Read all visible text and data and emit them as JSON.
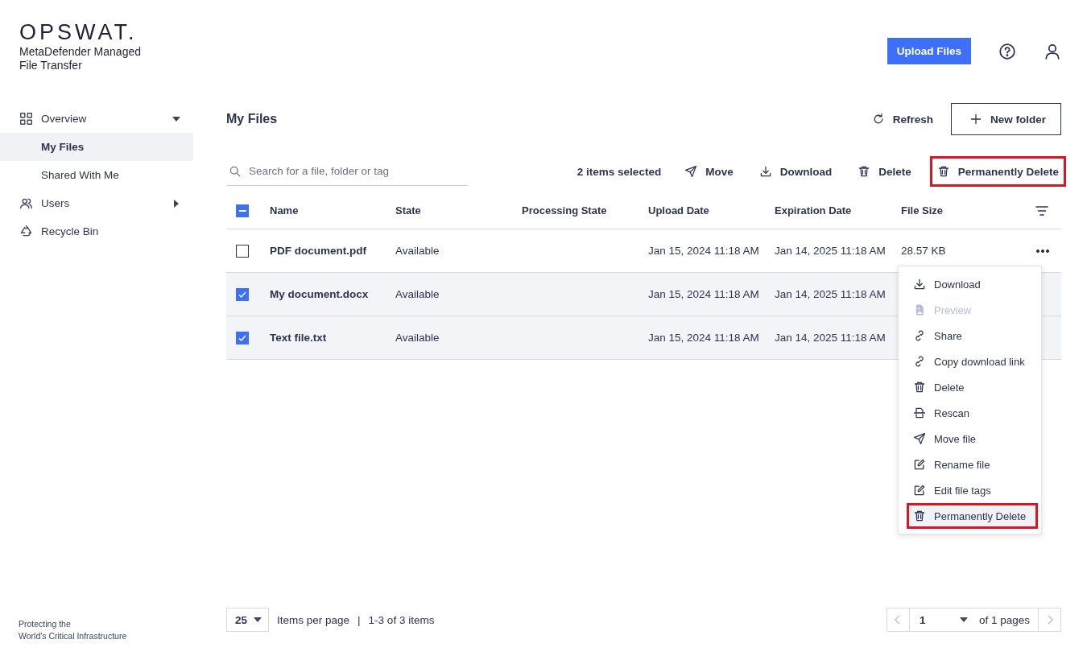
{
  "brand": {
    "logo": "OPSWAT.",
    "product": "MetaDefender Managed File Transfer",
    "tagline_lines": [
      "Protecting the",
      "World's Critical Infrastructure"
    ]
  },
  "header": {
    "upload_button": "Upload Files"
  },
  "sidebar": {
    "items": [
      {
        "label": "Overview",
        "expanded": true,
        "children": [
          {
            "label": "My Files",
            "selected": true
          },
          {
            "label": "Shared With Me",
            "selected": false
          }
        ]
      },
      {
        "label": "Users",
        "expanded": false
      },
      {
        "label": "Recycle Bin"
      }
    ]
  },
  "page": {
    "title": "My Files",
    "refresh": "Refresh",
    "new_folder": "New folder"
  },
  "search": {
    "placeholder": "Search for a file, folder or tag"
  },
  "bulk_actions": {
    "count": "2 items selected",
    "actions": [
      {
        "label": "Move",
        "highlighted": false
      },
      {
        "label": "Download",
        "highlighted": false
      },
      {
        "label": "Delete",
        "highlighted": false
      },
      {
        "label": "Permanently Delete",
        "highlighted": true
      }
    ]
  },
  "table": {
    "select_all": {
      "indeterminate": true
    },
    "columns": [
      "Name",
      "State",
      "Processing State",
      "Upload Date",
      "Expiration Date",
      "File Size"
    ],
    "rows": [
      {
        "name": "PDF document.pdf",
        "state": "Available",
        "processing_state": "",
        "upload": "Jan 15, 2024 11:18 AM",
        "expiration": "Jan 14, 2025 11:18 AM",
        "size": "28.57 KB",
        "selected": false
      },
      {
        "name": "My document.docx",
        "state": "Available",
        "upload": "Jan 15, 2024 11:18 AM",
        "expiration": "Jan 14, 2025 11:18 AM",
        "selected": true
      },
      {
        "name": "Text file.txt",
        "state": "Available",
        "upload": "Jan 15, 2024 11:18 AM",
        "expiration": "Jan 14, 2025 11:18 AM",
        "selected": true
      }
    ]
  },
  "context_menu": {
    "items": [
      {
        "label": "Download",
        "disabled": false,
        "highlighted": false
      },
      {
        "label": "Preview",
        "disabled": true,
        "highlighted": false
      },
      {
        "label": "Share",
        "disabled": false,
        "highlighted": false
      },
      {
        "label": "Copy download link",
        "disabled": false,
        "highlighted": false
      },
      {
        "label": "Delete",
        "disabled": false,
        "highlighted": false
      },
      {
        "label": "Rescan",
        "disabled": false,
        "highlighted": false
      },
      {
        "label": "Move file",
        "disabled": false,
        "highlighted": false
      },
      {
        "label": "Rename file",
        "disabled": false,
        "highlighted": false
      },
      {
        "label": "Edit file tags",
        "disabled": false,
        "highlighted": false
      },
      {
        "label": "Permanently Delete",
        "disabled": false,
        "highlighted": true
      }
    ]
  },
  "pagination": {
    "page_size": "25",
    "per_page_label": "Items per page",
    "separator": "|",
    "range": "1-3 of 3 items",
    "page": "1",
    "of_pages": "of 1 pages"
  }
}
